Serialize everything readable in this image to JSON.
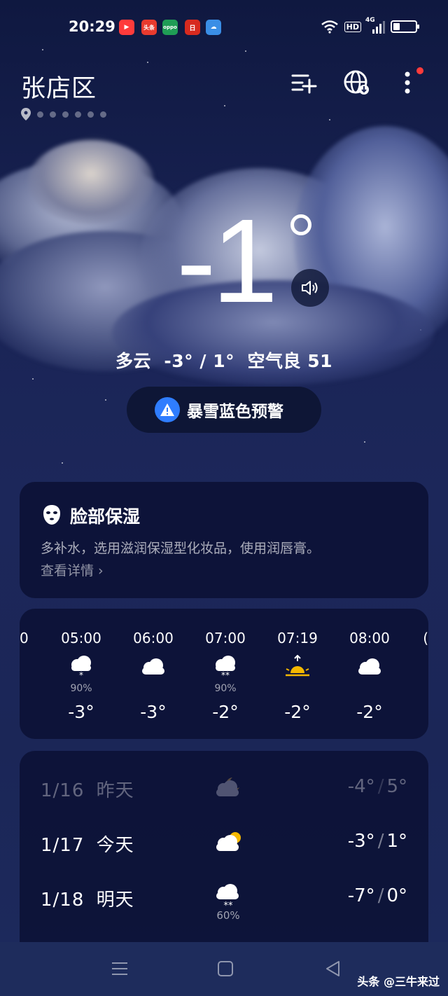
{
  "status_bar": {
    "time": "20:29",
    "app_badges": [
      {
        "name": "video-app-icon",
        "text": "",
        "color": "#ff3b3b"
      },
      {
        "name": "toutiao-app-icon",
        "text": "头条",
        "color": "#e83a2e"
      },
      {
        "name": "oppo-app-icon",
        "text": "oppo",
        "color": "#1f9d55"
      },
      {
        "name": "bank-app-icon",
        "text": "日",
        "color": "#d72a1f"
      },
      {
        "name": "weather-app-icon",
        "text": "",
        "color": "#3a8ee6"
      }
    ],
    "network": "4G",
    "hd_label": "HD",
    "battery_level": 0.3
  },
  "header": {
    "city": "张店区",
    "location_dots": 7,
    "icons": [
      "add-city-icon",
      "globe-icon",
      "more-icon"
    ],
    "has_notification": true
  },
  "current": {
    "temperature": "-1",
    "degree_symbol": "°",
    "summary": "多云  -3° / 1°  空气良 51"
  },
  "alert": {
    "label": "暴雪蓝色预警",
    "color": "#2f7dff"
  },
  "tip": {
    "icon": "face-mask-icon",
    "title": "脸部保湿",
    "description": "多补水，选用滋润保湿型化妆品，使用润唇膏。",
    "link": "查看详情 ›"
  },
  "hourly": [
    {
      "time": "05:00",
      "icon": "snow-icon",
      "pop": "90%",
      "temp": "-3°"
    },
    {
      "time": "06:00",
      "icon": "cloudy-icon",
      "pop": "",
      "temp": "-3°"
    },
    {
      "time": "07:00",
      "icon": "heavy-snow-icon",
      "pop": "90%",
      "temp": "-2°"
    },
    {
      "time": "07:19",
      "icon": "sunrise-icon",
      "pop": "",
      "temp": "-2°"
    },
    {
      "time": "08:00",
      "icon": "cloudy-icon",
      "pop": "",
      "temp": "-2°"
    }
  ],
  "daily": [
    {
      "date": "1/16",
      "label": "昨天",
      "icon": "cloudy-night-icon",
      "pop": "",
      "low": "-4°",
      "high": "5°",
      "past": true
    },
    {
      "date": "1/17",
      "label": "今天",
      "icon": "partly-cloudy-icon",
      "pop": "",
      "low": "-3°",
      "high": "1°",
      "past": false
    },
    {
      "date": "1/18",
      "label": "明天",
      "icon": "heavy-snow-icon",
      "pop": "60%",
      "low": "-7°",
      "high": "0°",
      "past": false
    }
  ],
  "watermark": "头条 @三牛来过"
}
